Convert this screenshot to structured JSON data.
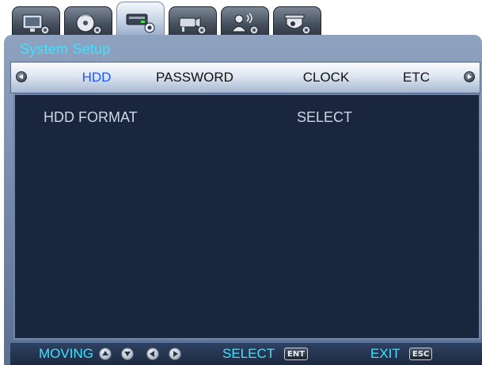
{
  "tabs": [
    {
      "icon": "monitor-settings-icon",
      "active": false
    },
    {
      "icon": "disc-settings-icon",
      "active": false
    },
    {
      "icon": "hdd-settings-icon",
      "active": true
    },
    {
      "icon": "camera-settings-icon",
      "active": false
    },
    {
      "icon": "user-settings-icon",
      "active": false
    },
    {
      "icon": "dome-camera-settings-icon",
      "active": false
    }
  ],
  "window": {
    "title": "System Setup"
  },
  "submenu": {
    "items": [
      "HDD",
      "PASSWORD",
      "CLOCK",
      "ETC"
    ],
    "active": "HDD"
  },
  "content": {
    "rows": [
      {
        "label": "HDD FORMAT",
        "value": "SELECT"
      }
    ]
  },
  "footer": {
    "moving_label": "MOVING",
    "select_label": "SELECT",
    "select_key": "ENT",
    "exit_label": "EXIT",
    "exit_key": "ESC"
  },
  "colors": {
    "accent_cyan": "#3ee2ff",
    "active_tab_text": "#1d55ff",
    "content_bg": "#1a253e"
  }
}
